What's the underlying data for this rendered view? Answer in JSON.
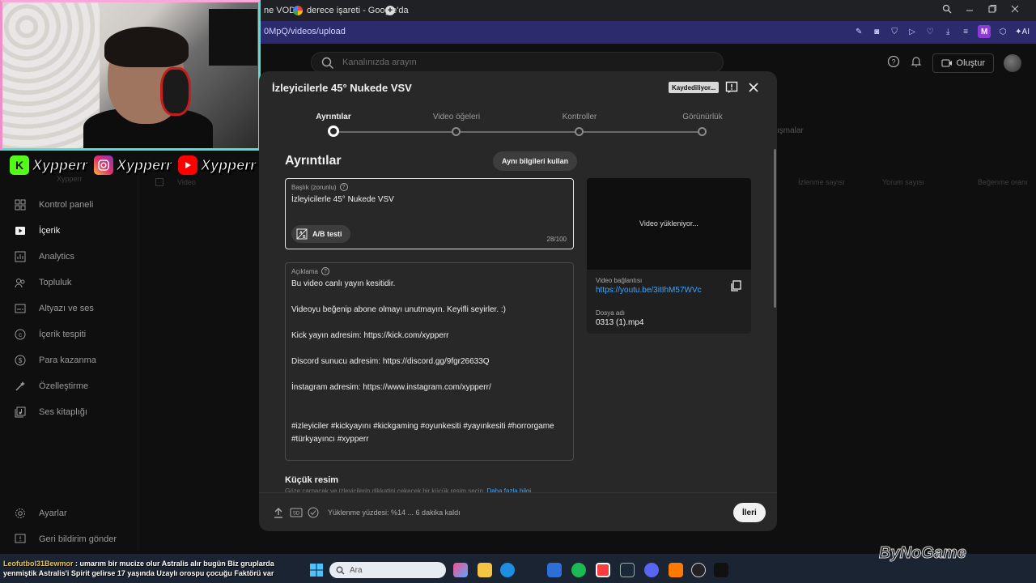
{
  "browser": {
    "tabs": [
      {
        "label": "ne VOD"
      },
      {
        "label": "derece işareti - Google'da"
      }
    ],
    "new_tab": "+",
    "url": "0MpQ/videos/upload",
    "ext_profile": "M",
    "ext_ai": "AI"
  },
  "topbar": {
    "search_placeholder": "Kanalınızda arayın",
    "create_label": "Oluştur"
  },
  "overlay": {
    "kick_name": "Xypperr",
    "instagram_name": "Xypperr",
    "youtube_name": "Xypperr",
    "channel_caption": "Xypperr"
  },
  "sidebar": {
    "items": [
      {
        "label": "Kontrol paneli",
        "icon": "dashboard-icon"
      },
      {
        "label": "İçerik",
        "icon": "content-icon"
      },
      {
        "label": "Analytics",
        "icon": "analytics-icon"
      },
      {
        "label": "Topluluk",
        "icon": "community-icon"
      },
      {
        "label": "Altyazı ve ses",
        "icon": "subtitles-icon"
      },
      {
        "label": "İçerik tespiti",
        "icon": "copyright-icon"
      },
      {
        "label": "Para kazanma",
        "icon": "monetization-icon"
      },
      {
        "label": "Özelleştirme",
        "icon": "customization-icon"
      },
      {
        "label": "Ses kitaplığı",
        "icon": "audio-library-icon"
      }
    ],
    "bottom": [
      {
        "label": "Ayarlar",
        "icon": "settings-icon"
      },
      {
        "label": "Geri bildirim gönder",
        "icon": "feedback-icon"
      }
    ]
  },
  "background_page": {
    "tab_fragment": "ışmalar",
    "columns": [
      "Video",
      "İzlenme sayısı",
      "Yorum sayısı",
      "Beğenme oranı"
    ]
  },
  "modal": {
    "title": "İzleyicilerle 45° Nukede VSV",
    "saving_badge": "Kaydediliyor...",
    "steps": [
      "Ayrıntılar",
      "Video öğeleri",
      "Kontroller",
      "Görünürlük"
    ],
    "section_title": "Ayrıntılar",
    "reuse_button": "Aynı bilgileri kullan",
    "title_field": {
      "label": "Başlık (zorunlu)",
      "value": "İzleyicilerle 45° Nukede VSV",
      "ab_button": "A/B testi",
      "char_count": "28/100"
    },
    "description_field": {
      "label": "Açıklama",
      "lines": [
        "Bu video canlı yayın kesitidir.",
        "Videoyu beğenip abone olmayı unutmayın. Keyifli seyirler. :)",
        "Kick yayın adresim: https://kick.com/xypperr",
        "Discord sunucu adresim: https://discord.gg/9fgr26633Q",
        "İnstagram adresim: https://www.instagram.com/xypperr/",
        "#izleyiciler  #kickyayını #kickgaming #oyunkesiti #yayınkesiti  #horrorgame",
        "#türkyayıncı #xypperr"
      ]
    },
    "preview": {
      "status": "Video yükleniyor...",
      "link_label": "Video bağlantısı",
      "link": "https://youtu.be/3itIhM57WVc",
      "filename_label": "Dosya adı",
      "filename": "0313 (1).mp4"
    },
    "thumbnail": {
      "title": "Küçük resim",
      "description": "Göze çarpacak ve izleyicilerin dikkatini çekecek bir küçük resim seçin.",
      "more_link": "Daha fazla bilgi"
    },
    "footer": {
      "upload_status": "Yüklenme yüzdesi: %14 ... 6 dakika kaldı",
      "next_button": "İleri"
    }
  },
  "chat": {
    "user": "Leofutbol31Bewmor",
    "line1": " : umarım bir mucize olur Astralis alır bugün Biz gruplarda",
    "line2": "yenmiştik Astralis'i Spirit gelirse 17 yaşında Uzaylı orospu çocuğu Faktörü var"
  },
  "taskbar": {
    "search_placeholder": "Ara"
  },
  "watermark": "ByNoGame"
}
